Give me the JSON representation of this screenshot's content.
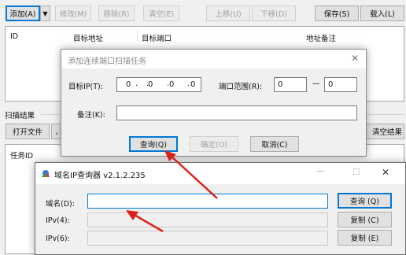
{
  "toolbar": {
    "add_label": "添加(A)",
    "dropdown_glyph": "▼",
    "edit_label": "修改(M)",
    "remove_label": "移除(R)",
    "clear_label": "清空(E)",
    "move_up_label": "上移(U)",
    "move_down_label": "下移(D)",
    "save_label": "保存(S)",
    "load_label": "载入(L)"
  },
  "task_table": {
    "columns": [
      "ID",
      "目标地址",
      "目标端口",
      "地址备注"
    ]
  },
  "scan_results": {
    "heading": "扫描结果",
    "open_file_label": "打开文件",
    "partial_button_glyph": "‚",
    "clear_results_label": "清空结果",
    "column_task_id": "任务ID"
  },
  "add_task_dialog": {
    "title": "添加连续端口扫描任务",
    "close_glyph": "✕",
    "target_ip_label": "目标IP(T):",
    "ip_value": ". 0 . 0 . 0 . 0",
    "ip_octets": [
      "0",
      "0",
      "0",
      "0"
    ],
    "port_range_label": "端口范围(R):",
    "port_from": "0",
    "port_dash": "—",
    "port_to": "0",
    "note_label": "备注(K):",
    "note_value": "",
    "query_button": "查询(Q)",
    "ok_button": "确定(O)",
    "cancel_button": "取消(C)"
  },
  "ip_lookup_window": {
    "title": "域名IP查询器 v2.1.2.235",
    "minimize_glyph": "—",
    "maximize_glyph": "☐",
    "close_glyph": "✕",
    "domain_label": "域名(D):",
    "domain_value": "",
    "ipv4_label": "IPv(4):",
    "ipv4_value": "",
    "ipv6_label": "IPv(6):",
    "ipv6_value": "",
    "query_button": "查询 (Q)",
    "copy_button_1": "复制 (C)",
    "copy_button_2": "复制 (E)"
  },
  "colors": {
    "arrow": "#d9241b",
    "focus_blue": "#0078d7",
    "dialog_bg": "#f0f0f0"
  }
}
